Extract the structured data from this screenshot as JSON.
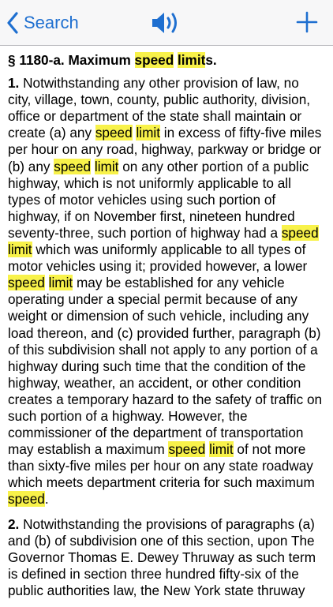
{
  "nav": {
    "back_label": "Search",
    "back_icon": "chevron-left-icon",
    "audio_icon": "speaker-icon",
    "add_icon": "plus-icon",
    "accent": "#1e6fd0"
  },
  "highlight_color": "#f8f24a",
  "document": {
    "title": [
      {
        "t": "§ 1180-a. Maximum "
      },
      {
        "t": "speed",
        "h": true
      },
      {
        "t": " "
      },
      {
        "t": "limit",
        "h": true
      },
      {
        "t": "s."
      }
    ],
    "paragraphs": [
      {
        "number": "1.",
        "segments": [
          {
            "t": " Notwithstanding any other provision of law, no city, village, town, county, public authority, division, office or department of the state shall maintain or create (a) any "
          },
          {
            "t": "speed",
            "h": true
          },
          {
            "t": " "
          },
          {
            "t": "limit",
            "h": true
          },
          {
            "t": " in excess of fifty-five miles per hour on any road, highway, parkway or bridge or (b) any "
          },
          {
            "t": "speed",
            "h": true
          },
          {
            "t": " "
          },
          {
            "t": "limit",
            "h": true
          },
          {
            "t": " on any other portion of a public highway, which is not uniformly applicable to all types of motor vehicles using such portion of highway, if on November first, nineteen hundred seventy-three, such portion of highway had a "
          },
          {
            "t": "speed",
            "h": true
          },
          {
            "t": " "
          },
          {
            "t": "limit",
            "h": true
          },
          {
            "t": " which was uniformly applicable to all types of motor vehicles using it; provided however, a lower "
          },
          {
            "t": "speed",
            "h": true
          },
          {
            "t": " "
          },
          {
            "t": "limit",
            "h": true
          },
          {
            "t": " may be established for any vehicle operating under a special permit because of any weight or dimension of such vehicle, including any load thereon, and (c) provided further, paragraph (b) of this subdivision shall not apply to any portion of a highway during such time that the condition of the highway, weather, an accident, or other condition creates a temporary hazard to the safety of traffic on such portion of a highway. However, the commissioner of the department of transportation may establish a maximum "
          },
          {
            "t": "speed",
            "h": true
          },
          {
            "t": " "
          },
          {
            "t": "limit",
            "h": true
          },
          {
            "t": " of not more than sixty-five miles per hour on any state roadway which meets department criteria for such maximum "
          },
          {
            "t": "speed",
            "h": true
          },
          {
            "t": "."
          }
        ]
      },
      {
        "number": "2.",
        "segments": [
          {
            "t": " Notwithstanding the provisions of paragraphs (a) and (b) of subdivision one of this section, upon The Governor Thomas E. Dewey Thruway as such term is defined in section three hundred fifty-six of the public authorities law, the New York state thruway"
          }
        ]
      }
    ]
  }
}
